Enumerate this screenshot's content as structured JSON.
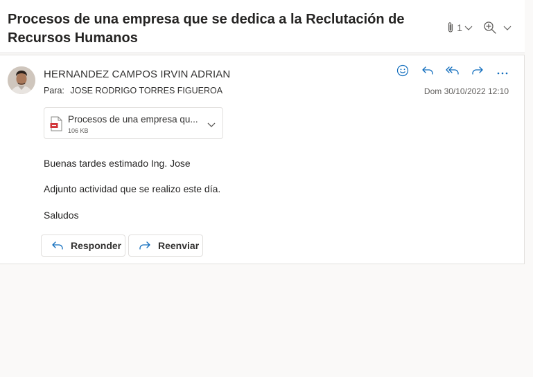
{
  "subject": "Procesos de una empresa que se dedica a la Reclutación de Recursos Humanos",
  "header_tools": {
    "attachment_count": "1",
    "attachment_icon": "paperclip-icon",
    "zoom_icon": "zoom-in-icon"
  },
  "message": {
    "sender": "HERNANDEZ CAMPOS IRVIN ADRIAN",
    "to_label": "Para:",
    "to": "JOSE RODRIGO TORRES FIGUEROA",
    "date": "Dom 30/10/2022 12:10",
    "actions": [
      "emoji-icon",
      "reply-icon",
      "reply-all-icon",
      "forward-icon",
      "more-icon"
    ],
    "attachment": {
      "name": "Procesos de una empresa qu...",
      "size": "106 KB",
      "icon": "pdf-file-icon"
    },
    "body": [
      "Buenas tardes estimado Ing. Jose",
      "Adjunto actividad que se realizo este día.",
      "Saludos"
    ],
    "reply_button": "Responder",
    "forward_button": "Reenviar"
  },
  "colors": {
    "accent": "#0f6cbd",
    "background": "#faf9f8",
    "card": "#ffffff",
    "border": "#e1dfdd"
  }
}
